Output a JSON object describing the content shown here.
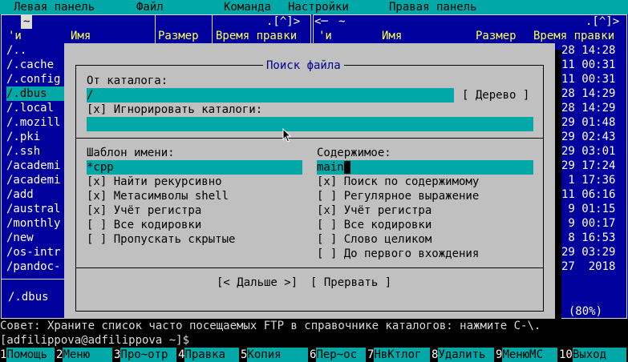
{
  "menubar": {
    "left_panel": "Левая панель",
    "file": "Файл",
    "command": "Команда",
    "settings": "Настройки",
    "right_panel": "Правая панель"
  },
  "left_panel": {
    "path": "~",
    "scroll_marker": ".[^]>",
    "headers": {
      "sort": "'и",
      "name": "Имя",
      "size": "Размер",
      "mtime": "Время правки"
    },
    "rows": [
      "/..",
      "/.cache",
      "/.config",
      "/.dbus",
      "/.local",
      "/.mozill",
      "/.pki",
      "/.ssh",
      "/academi",
      "/academi",
      "/add",
      "/austral",
      "/monthly",
      "/new",
      "/os-intr",
      "/pandoc-"
    ],
    "status": "/.dbus"
  },
  "right_panel": {
    "path": "~",
    "scroll_marker": ".[^]>",
    "headers": {
      "sort": "'и",
      "name": "Имя",
      "size": "Размер",
      "mtime": "Время правки"
    },
    "times": [
      "28 14:28",
      "11 00:31",
      "11 00:31",
      "28 14:29",
      "28 14:29",
      "29 01:48",
      "29 02:43",
      "29 03:01",
      "29 17:24",
      " 1 17:36",
      "11 06:16",
      " 9 01:15",
      " 9 00:17",
      " 8 16:53",
      "29 03:29",
      "27  2018"
    ],
    "disk_status": "G (80%)"
  },
  "dialog": {
    "title": "Поиск файла",
    "from_dir_label": "От каталога:",
    "from_dir_value": "/",
    "tree_button": "[ Дерево ]",
    "ignore_dirs": "[x] Игнорировать каталоги:",
    "ignore_dirs_value": "",
    "name_pattern_label": "Шаблон имени:",
    "name_pattern_value": "*cpp",
    "content_label": "Содержимое:",
    "content_value": "main",
    "left_opts": [
      "[x] Найти рекурсивно",
      "[x] Метасимволы shell",
      "[x] Учёт регистра",
      "[ ] Все кодировки",
      "[ ] Пропускать скрытые"
    ],
    "right_opts": [
      "[x] Поиск по содержимому",
      "[ ] Регулярное выражение",
      "[x] Учёт регистра",
      "[ ] Все кодировки",
      "[ ] Слово целиком",
      "[ ] До первого вхождения"
    ],
    "continue_button": "[< Дальше >]",
    "abort_button": "[ Прервать ]"
  },
  "hint": "Совет: Храните список часто посещаемых FTP в справочнике каталогов: нажмите C-\\.",
  "prompt": "[adfilippova@adfilippova ~]$",
  "fkeys": [
    {
      "n": "1",
      "l": "Помощь"
    },
    {
      "n": "2",
      "l": "Меню"
    },
    {
      "n": "3",
      "l": "Про~отр"
    },
    {
      "n": "4",
      "l": "Правка"
    },
    {
      "n": "5",
      "l": "Копия"
    },
    {
      "n": "6",
      "l": "Пер~ос"
    },
    {
      "n": "7",
      "l": "НвКтлог"
    },
    {
      "n": "8",
      "l": "Удалить"
    },
    {
      "n": "9",
      "l": "МенюМС"
    },
    {
      "n": "10",
      "l": "Выход"
    }
  ]
}
